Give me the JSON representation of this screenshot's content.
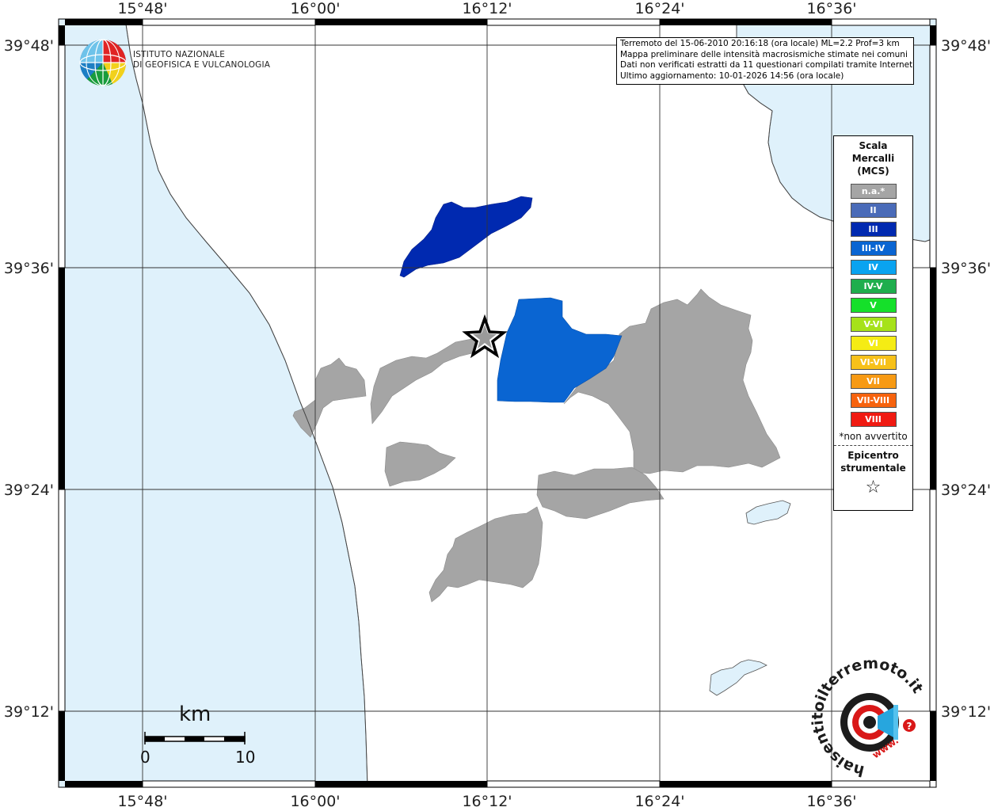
{
  "map": {
    "axes": {
      "longitude_ticks": [
        "15°48'",
        "16°00'",
        "16°12'",
        "16°24'",
        "16°36'"
      ],
      "latitude_ticks": [
        "39°48'",
        "39°36'",
        "39°24'",
        "39°12'"
      ]
    },
    "colors": {
      "sea": "#dff1fb",
      "land": "#ffffff",
      "not_felt": "#a5a5a5",
      "intensity_III": "#0029b0",
      "intensity_III_IV": "#0a65d2",
      "grid": "#333333",
      "frame": "#000000"
    }
  },
  "info_box": {
    "lines": [
      "Terremoto del 15-06-2010 20:16:18 (ora locale) ML=2.2 Prof=3 km",
      "Mappa preliminare delle intensità macrosismiche stimate nei comuni",
      "Dati non verificati estratti da 11 questionari compilati tramite Internet.",
      "Ultimo aggiornamento: 10-01-2026 14:56 (ora locale)"
    ]
  },
  "logo": {
    "line1": "ISTITUTO NAZIONALE",
    "line2": "DI GEOFISICA E VULCANOLOGIA"
  },
  "legend": {
    "title_lines": [
      "Scala",
      "Mercalli",
      "(MCS)"
    ],
    "items": [
      {
        "label": "n.a.*",
        "color": "#a5a5a5"
      },
      {
        "label": "II",
        "color": "#4a6bb8"
      },
      {
        "label": "III",
        "color": "#0029b0"
      },
      {
        "label": "III-IV",
        "color": "#0a65d2"
      },
      {
        "label": "IV",
        "color": "#0aa3f0"
      },
      {
        "label": "IV-V",
        "color": "#1fae4d"
      },
      {
        "label": "V",
        "color": "#15e02a"
      },
      {
        "label": "V-VI",
        "color": "#a6e21a"
      },
      {
        "label": "VI",
        "color": "#f5ec14"
      },
      {
        "label": "VI-VII",
        "color": "#f7c11a"
      },
      {
        "label": "VII",
        "color": "#f79a14"
      },
      {
        "label": "VII-VIII",
        "color": "#f7630e"
      },
      {
        "label": "VIII",
        "color": "#f01a12"
      }
    ],
    "note": "*non avvertito",
    "epicenter_lines": [
      "Epicentro",
      "strumentale"
    ],
    "epicenter_symbol": "☆"
  },
  "scale_bar": {
    "unit": "km",
    "start": "0",
    "end": "10"
  },
  "brand": {
    "ring_text": "haisentitoilterremoto.it",
    "sub_text": "www.",
    "question": "?"
  }
}
